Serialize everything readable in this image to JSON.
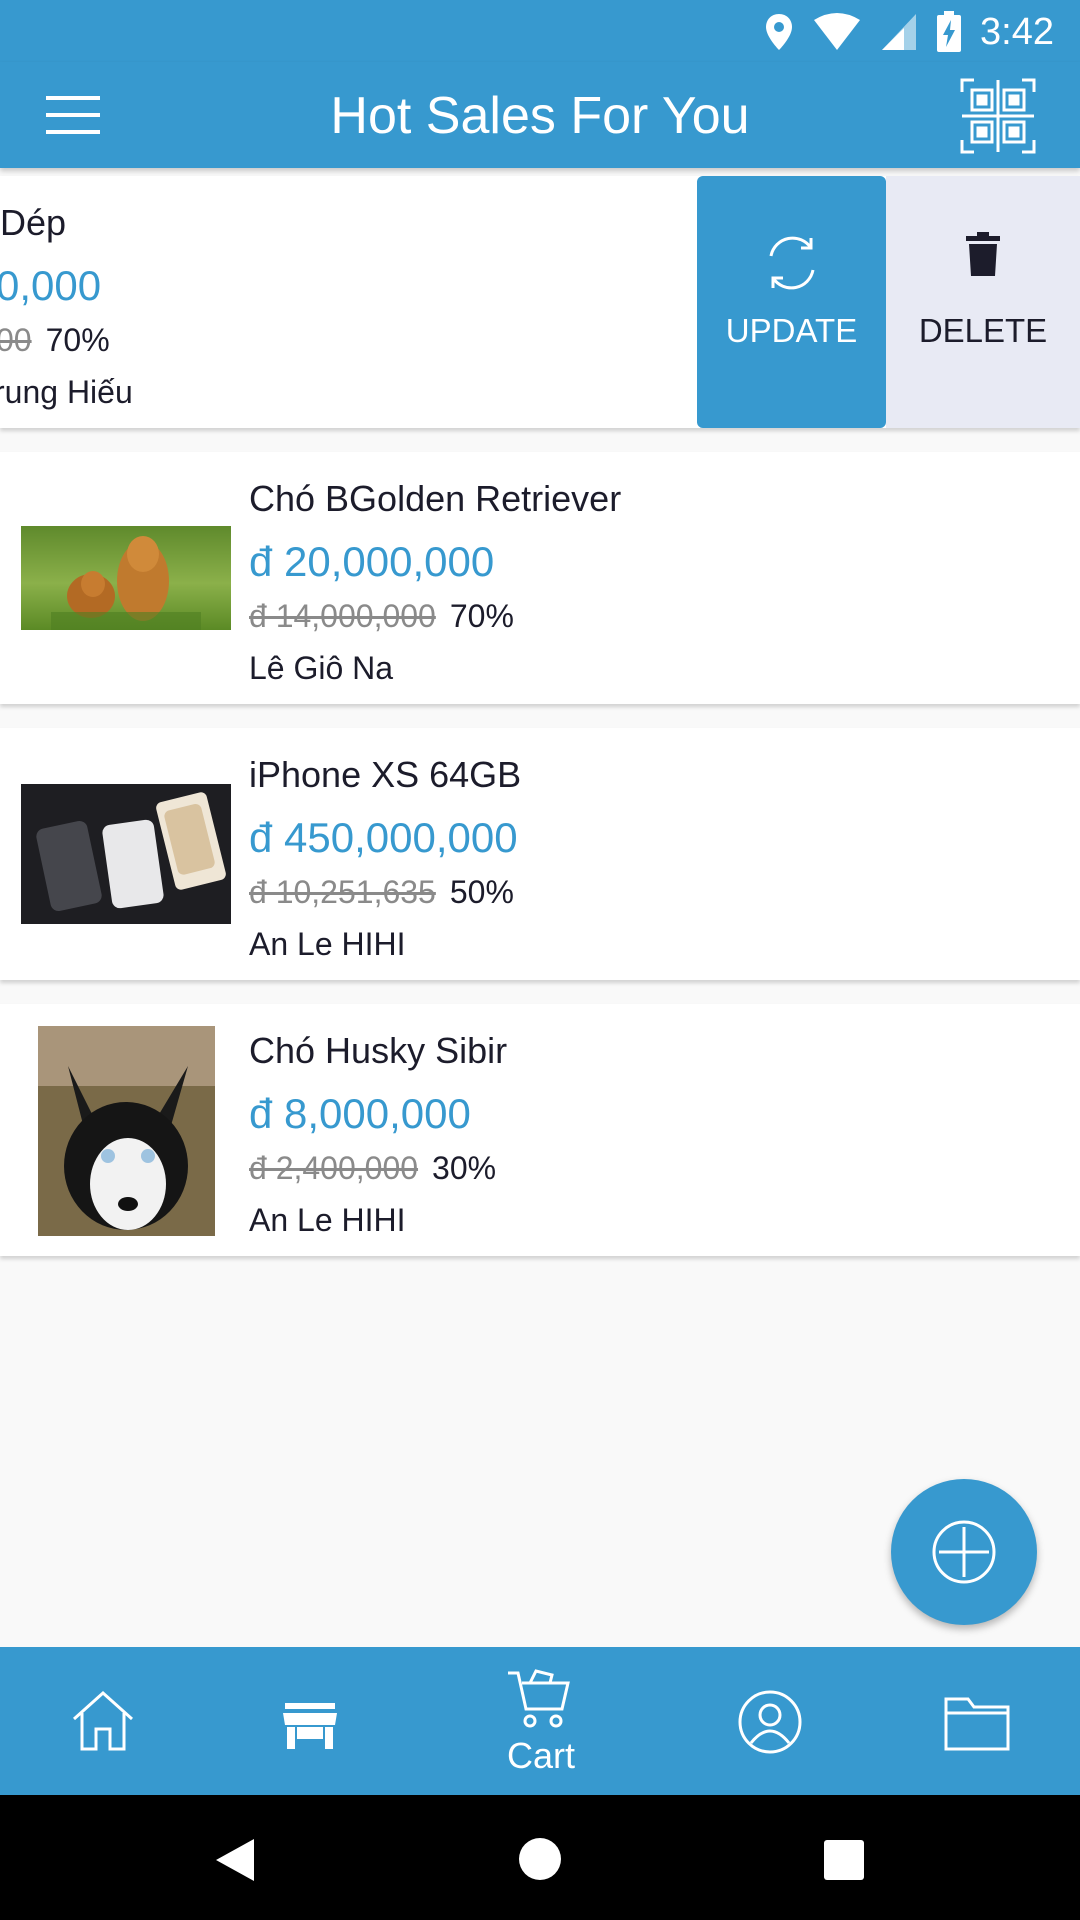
{
  "status_bar": {
    "time": "3:42",
    "icons": [
      "location-icon",
      "wifi-icon",
      "signal-icon",
      "battery-charging-icon"
    ]
  },
  "app_bar": {
    "title": "Hot Sales For You",
    "left_icon": "menu-icon",
    "right_icon": "qr-code-icon"
  },
  "products": [
    {
      "name": "Dép",
      "price": "0,000",
      "old_price": "00",
      "discount": "70%",
      "seller": "rung Hiếu",
      "swiped": true
    },
    {
      "name": "Chó BGolden Retriever",
      "price": "đ 20,000,000",
      "old_price": "đ 14,000,000",
      "discount": "70%",
      "seller": "Lê Giô Na",
      "image": "golden-retriever-photo"
    },
    {
      "name": "iPhone XS 64GB",
      "price": "đ 450,000,000",
      "old_price": "đ 10,251,635",
      "discount": "50%",
      "seller": "An Le HIHI",
      "image": "iphone-xs-photo"
    },
    {
      "name": "Chó Husky Sibir",
      "price": "đ 8,000,000",
      "old_price": "đ 2,400,000",
      "discount": "30%",
      "seller": "An Le HIHI",
      "image": "husky-photo"
    }
  ],
  "swipe_actions": {
    "update_label": "UPDATE",
    "update_icon": "refresh-icon",
    "delete_label": "DELETE",
    "delete_icon": "trash-icon"
  },
  "fab": {
    "icon": "add-circle-icon"
  },
  "bottom_nav": {
    "items": [
      {
        "icon": "home-icon",
        "label": ""
      },
      {
        "icon": "store-icon",
        "label": ""
      },
      {
        "icon": "cart-icon",
        "label": "Cart"
      },
      {
        "icon": "profile-icon",
        "label": ""
      },
      {
        "icon": "folder-icon",
        "label": ""
      }
    ]
  },
  "system_nav": [
    "back-icon",
    "home-circle-icon",
    "recents-icon"
  ],
  "colors": {
    "primary": "#3799cf",
    "background": "#f9f9f9",
    "delete_bg": "#e8eaf4",
    "text_dark": "#1c1c2b",
    "strikethrough": "#8a8a8a"
  }
}
